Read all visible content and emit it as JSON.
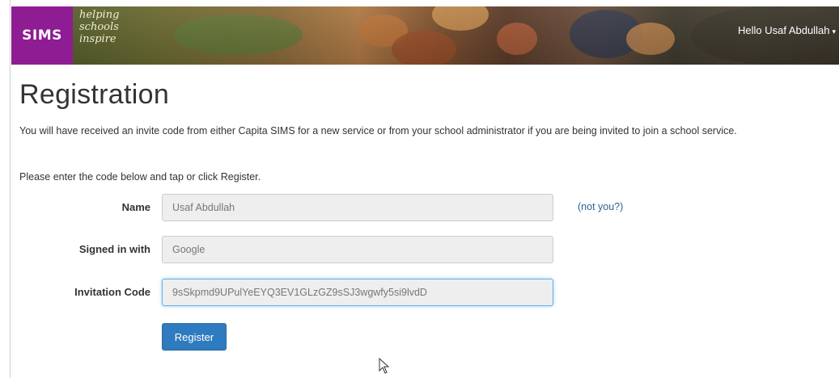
{
  "header": {
    "logo_text": "SIMS",
    "tagline": [
      "helping",
      "schools",
      "inspire"
    ],
    "greeting": "Hello Usaf Abdullah",
    "brand_color": "#8e1c93"
  },
  "page": {
    "title": "Registration",
    "intro": "You will have received an invite code from either Capita SIMS for a new service or from your school administrator if you are being invited to join a school service.",
    "instruction": "Please enter the code below and tap or click Register."
  },
  "form": {
    "name_label": "Name",
    "name_value": "Usaf Abdullah",
    "not_you_link": "(not you?)",
    "signed_in_label": "Signed in with",
    "signed_in_value": "Google",
    "invitation_label": "Invitation Code",
    "invitation_value": "9sSkpmd9UPulYeEYQ3EV1GLzGZ9sSJ3wgwfy5si9lvdD",
    "register_label": "Register",
    "button_color": "#2f7bbf",
    "link_color": "#2a6496"
  }
}
